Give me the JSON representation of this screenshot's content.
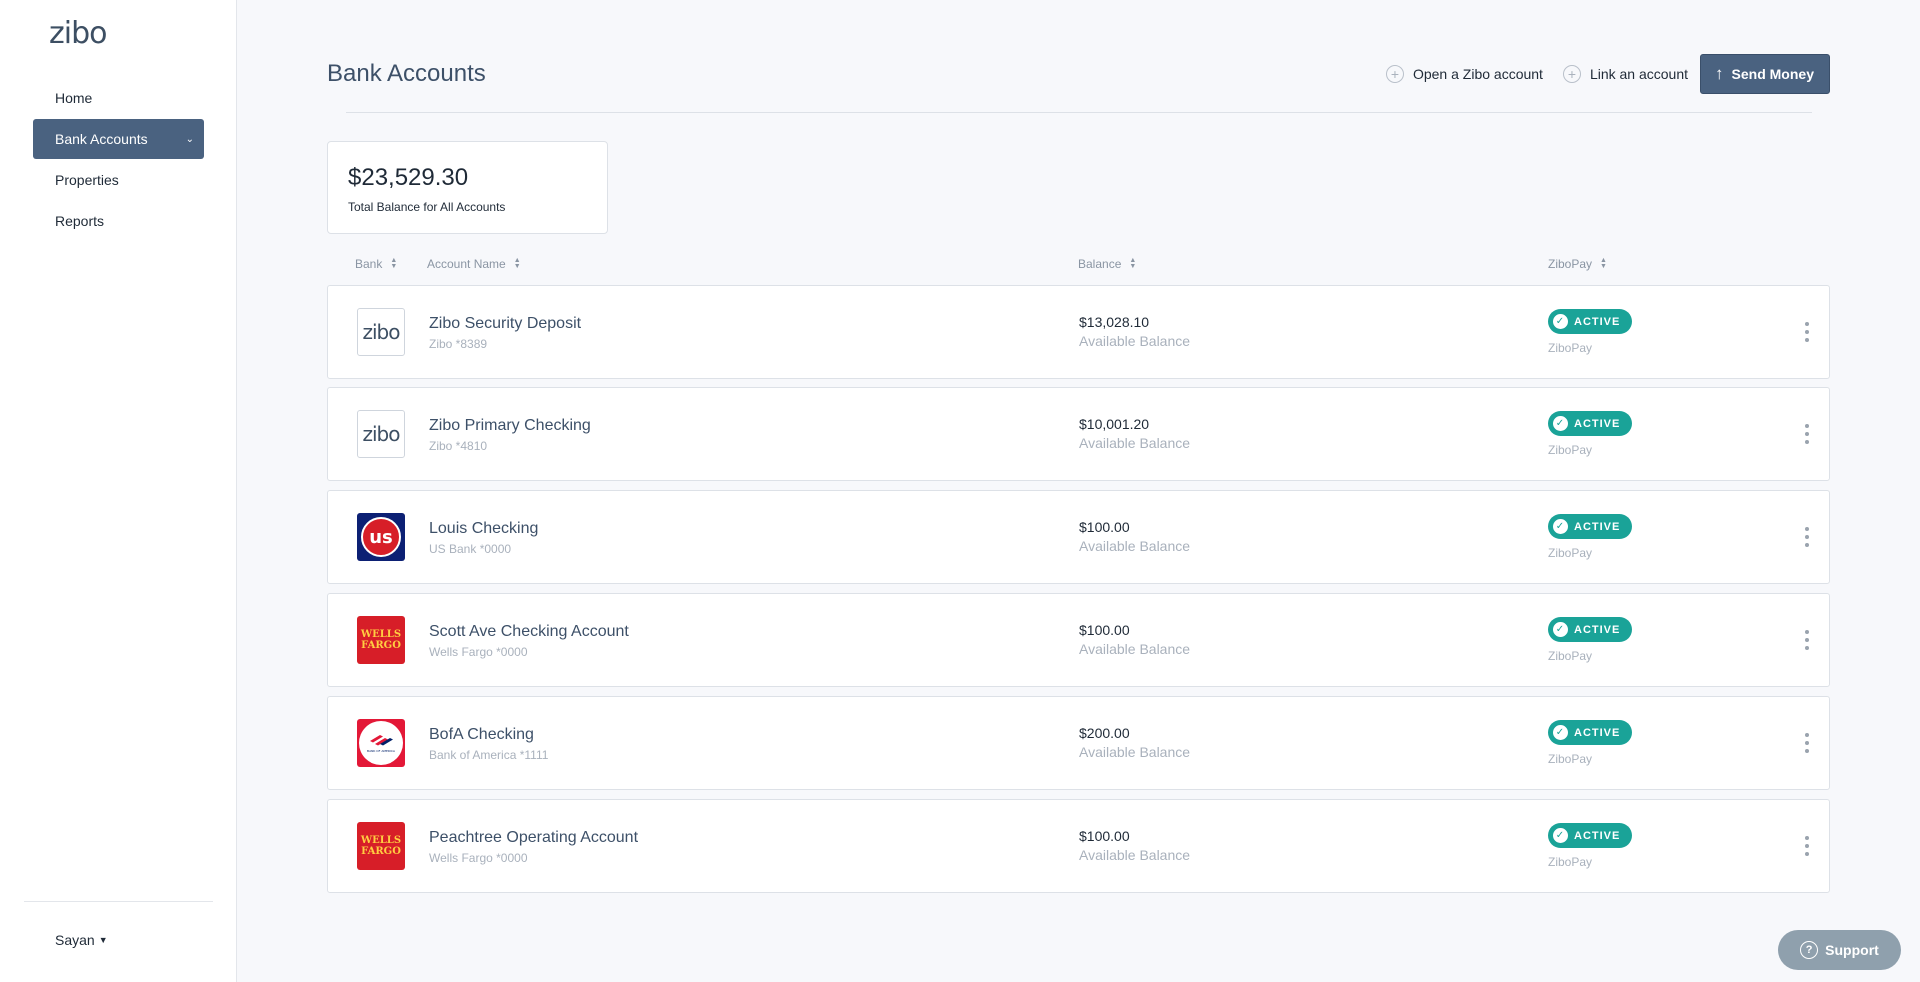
{
  "app": {
    "logo": "zibo"
  },
  "sidebar": {
    "items": [
      {
        "label": "Home"
      },
      {
        "label": "Bank Accounts",
        "active": true
      },
      {
        "label": "Properties"
      },
      {
        "label": "Reports"
      }
    ],
    "user": "Sayan"
  },
  "header": {
    "title": "Bank Accounts",
    "open_account": "Open a Zibo account",
    "link_account": "Link an account",
    "send_money": "Send Money"
  },
  "total": {
    "value": "$23,529.30",
    "label": "Total Balance for All Accounts"
  },
  "columns": {
    "bank": "Bank",
    "account_name": "Account Name",
    "balance": "Balance",
    "zibopay": "ZiboPay"
  },
  "accounts": [
    {
      "name": "Zibo Security Deposit",
      "sub": "Zibo *8389",
      "balance": "$13,028.10",
      "balance_label": "Available Balance",
      "status": "ACTIVE",
      "status_sub": "ZiboPay",
      "logo": "zibo",
      "logo_text": "zibo"
    },
    {
      "name": "Zibo Primary Checking",
      "sub": "Zibo *4810",
      "balance": "$10,001.20",
      "balance_label": "Available Balance",
      "status": "ACTIVE",
      "status_sub": "ZiboPay",
      "logo": "zibo",
      "logo_text": "zibo"
    },
    {
      "name": "Louis Checking",
      "sub": "US Bank *0000",
      "balance": "$100.00",
      "balance_label": "Available Balance",
      "status": "ACTIVE",
      "status_sub": "ZiboPay",
      "logo": "us-bank",
      "logo_text": "us"
    },
    {
      "name": "Scott Ave Checking Account",
      "sub": "Wells Fargo *0000",
      "balance": "$100.00",
      "balance_label": "Available Balance",
      "status": "ACTIVE",
      "status_sub": "ZiboPay",
      "logo": "wells-fargo",
      "logo_text": "WELLS FARGO"
    },
    {
      "name": "BofA Checking",
      "sub": "Bank of America *1111",
      "balance": "$200.00",
      "balance_label": "Available Balance",
      "status": "ACTIVE",
      "status_sub": "ZiboPay",
      "logo": "bank-of-america",
      "logo_text": "BANK OF AMERICA"
    },
    {
      "name": "Peachtree Operating Account",
      "sub": "Wells Fargo *0000",
      "balance": "$100.00",
      "balance_label": "Available Balance",
      "status": "ACTIVE",
      "status_sub": "ZiboPay",
      "logo": "wells-fargo",
      "logo_text": "WELLS FARGO"
    }
  ],
  "support": {
    "label": "Support"
  },
  "colors": {
    "primary": "#4a6280",
    "active_badge": "#1aa398",
    "background": "#f7f8fb"
  }
}
